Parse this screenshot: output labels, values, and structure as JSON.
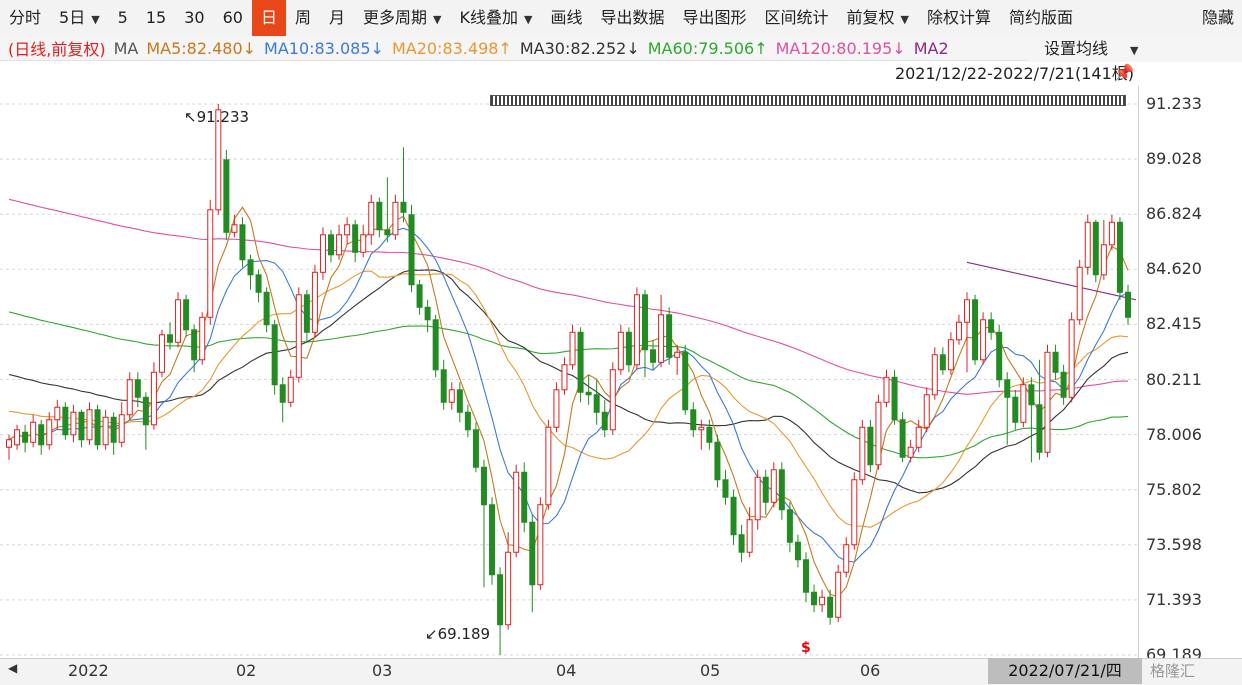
{
  "toolbar": {
    "items": [
      "分时",
      "5日",
      "5",
      "15",
      "30",
      "60",
      "日",
      "周",
      "月",
      "更多周期",
      "K线叠加",
      "画线",
      "导出数据",
      "导出图形",
      "区间统计",
      "前复权",
      "除权计算",
      "简约版面"
    ],
    "right_label": "隐藏",
    "active": "日"
  },
  "ma": {
    "prefix": "(日线,前复权)",
    "label": "MA",
    "ma5": "MA5:82.480↓",
    "ma10": "MA10:83.085↓",
    "ma20": "MA20:83.498↑",
    "ma30": "MA30:82.252↓",
    "ma60": "MA60:79.506↑",
    "ma120": "MA120:80.195↓",
    "ma250": "MA2",
    "settings": "设置均线"
  },
  "range": "2021/12/22-2022/7/21(141根)",
  "annotations": {
    "high": "91.233",
    "low": "69.189",
    "signal": "$"
  },
  "price_axis": [
    "91.233",
    "89.028",
    "86.824",
    "84.620",
    "82.415",
    "80.211",
    "78.006",
    "75.802",
    "73.598",
    "71.393",
    "69.189"
  ],
  "time_axis": [
    "2022",
    "02",
    "03",
    "04",
    "05",
    "06"
  ],
  "current_date": "2022/07/21/四",
  "logo": "格隆汇",
  "colors": {
    "up": "#e02020",
    "down": "#228b22",
    "ma5": "#c8781e",
    "ma10": "#3a7ad8",
    "ma20": "#e89830",
    "ma30": "#333333",
    "ma60": "#2ea82e",
    "ma120": "#e050a0",
    "ma250": "#8a2a8a"
  },
  "chart_data": {
    "type": "candlestick",
    "ylim": [
      69.189,
      91.233
    ],
    "candles": [
      [
        77.5,
        77.8,
        77.0,
        78.0
      ],
      [
        77.6,
        78.2,
        77.4,
        78.4
      ],
      [
        78.1,
        77.7,
        77.3,
        78.4
      ],
      [
        77.7,
        78.5,
        77.5,
        78.8
      ],
      [
        78.4,
        77.6,
        77.2,
        78.6
      ],
      [
        77.6,
        78.6,
        77.4,
        78.9
      ],
      [
        78.6,
        79.1,
        78.2,
        79.4
      ],
      [
        79.1,
        78.0,
        77.8,
        79.3
      ],
      [
        78.0,
        78.9,
        77.7,
        79.2
      ],
      [
        78.9,
        77.8,
        77.5,
        79.0
      ],
      [
        77.8,
        79.0,
        77.6,
        79.3
      ],
      [
        79.0,
        77.6,
        77.4,
        79.2
      ],
      [
        77.6,
        78.7,
        77.4,
        79.0
      ],
      [
        78.7,
        77.7,
        77.2,
        78.9
      ],
      [
        77.7,
        78.8,
        77.5,
        79.3
      ],
      [
        78.8,
        80.2,
        78.6,
        80.5
      ],
      [
        80.2,
        79.5,
        79.1,
        80.5
      ],
      [
        79.5,
        78.4,
        77.4,
        79.7
      ],
      [
        78.4,
        80.5,
        78.2,
        80.9
      ],
      [
        80.5,
        82.0,
        80.3,
        82.2
      ],
      [
        82.0,
        81.7,
        81.4,
        82.5
      ],
      [
        81.7,
        83.4,
        81.5,
        83.7
      ],
      [
        83.4,
        82.2,
        81.9,
        83.6
      ],
      [
        82.2,
        81.0,
        80.5,
        82.4
      ],
      [
        81.0,
        82.7,
        80.8,
        82.9
      ],
      [
        82.7,
        87.0,
        82.4,
        87.4
      ],
      [
        87.0,
        91.0,
        86.8,
        91.233
      ],
      [
        89.0,
        86.1,
        85.8,
        89.4
      ],
      [
        86.1,
        86.4,
        85.9,
        86.8
      ],
      [
        86.4,
        85.0,
        84.7,
        86.7
      ],
      [
        85.0,
        84.4,
        83.8,
        85.2
      ],
      [
        84.4,
        83.7,
        83.3,
        84.6
      ],
      [
        83.7,
        82.4,
        82.1,
        83.9
      ],
      [
        82.4,
        80.0,
        79.6,
        82.6
      ],
      [
        80.0,
        79.3,
        78.5,
        80.3
      ],
      [
        79.3,
        80.3,
        79.1,
        80.6
      ],
      [
        80.3,
        83.6,
        80.1,
        83.9
      ],
      [
        83.6,
        82.1,
        81.7,
        83.8
      ],
      [
        82.1,
        84.5,
        81.9,
        84.8
      ],
      [
        84.5,
        86.0,
        84.2,
        86.3
      ],
      [
        86.0,
        85.2,
        84.9,
        86.2
      ],
      [
        85.2,
        86.0,
        85.0,
        86.4
      ],
      [
        86.0,
        86.4,
        85.6,
        86.7
      ],
      [
        86.4,
        85.3,
        84.9,
        86.6
      ],
      [
        85.3,
        86.0,
        85.1,
        86.4
      ],
      [
        86.0,
        87.3,
        85.6,
        87.6
      ],
      [
        87.3,
        86.2,
        85.9,
        87.5
      ],
      [
        86.2,
        86.0,
        85.7,
        88.3
      ],
      [
        86.0,
        87.3,
        85.8,
        87.6
      ],
      [
        87.3,
        86.9,
        86.5,
        89.5
      ],
      [
        86.8,
        84.0,
        83.7,
        87.2
      ],
      [
        84.0,
        83.1,
        82.8,
        84.2
      ],
      [
        83.1,
        82.6,
        82.1,
        83.4
      ],
      [
        82.6,
        80.6,
        80.3,
        82.8
      ],
      [
        80.6,
        79.3,
        79.0,
        81.0
      ],
      [
        79.3,
        79.8,
        79.0,
        80.1
      ],
      [
        79.8,
        78.9,
        78.5,
        80.1
      ],
      [
        78.9,
        78.2,
        77.9,
        79.2
      ],
      [
        78.2,
        76.7,
        76.5,
        78.5
      ],
      [
        76.7,
        75.2,
        71.9,
        77.0
      ],
      [
        75.2,
        72.4,
        72.0,
        75.5
      ],
      [
        72.4,
        70.4,
        69.189,
        72.7
      ],
      [
        70.4,
        73.3,
        70.2,
        74.1
      ],
      [
        73.3,
        76.5,
        73.1,
        76.8
      ],
      [
        76.5,
        74.5,
        74.1,
        76.9
      ],
      [
        74.5,
        72.0,
        70.9,
        74.8
      ],
      [
        72.0,
        75.2,
        71.8,
        75.5
      ],
      [
        75.2,
        78.3,
        75.0,
        78.6
      ],
      [
        78.3,
        79.8,
        78.1,
        80.1
      ],
      [
        79.8,
        80.8,
        79.6,
        81.1
      ],
      [
        80.8,
        82.1,
        80.6,
        82.4
      ],
      [
        82.1,
        79.7,
        79.3,
        82.3
      ],
      [
        79.7,
        79.6,
        79.2,
        80.4
      ],
      [
        79.6,
        78.9,
        78.4,
        80.2
      ],
      [
        78.9,
        78.2,
        77.9,
        79.4
      ],
      [
        78.2,
        80.6,
        78.0,
        80.9
      ],
      [
        80.6,
        82.1,
        80.4,
        82.4
      ],
      [
        82.1,
        80.8,
        80.5,
        82.3
      ],
      [
        80.8,
        83.6,
        80.6,
        83.9
      ],
      [
        83.6,
        81.4,
        80.3,
        83.8
      ],
      [
        81.4,
        80.9,
        80.6,
        81.8
      ],
      [
        80.9,
        82.8,
        80.7,
        83.6
      ],
      [
        82.8,
        81.1,
        80.8,
        83.1
      ],
      [
        81.1,
        81.3,
        80.4,
        81.6
      ],
      [
        81.3,
        79.0,
        78.8,
        81.6
      ],
      [
        79.0,
        78.2,
        77.9,
        79.3
      ],
      [
        78.2,
        78.3,
        77.4,
        78.6
      ],
      [
        78.3,
        77.7,
        77.4,
        78.6
      ],
      [
        77.7,
        76.2,
        75.9,
        78.0
      ],
      [
        76.2,
        75.5,
        75.2,
        76.6
      ],
      [
        75.5,
        74.0,
        73.6,
        75.8
      ],
      [
        74.0,
        73.3,
        72.9,
        74.4
      ],
      [
        73.3,
        74.6,
        73.1,
        75.1
      ],
      [
        74.6,
        76.3,
        74.2,
        76.6
      ],
      [
        76.3,
        75.3,
        74.8,
        76.6
      ],
      [
        75.3,
        76.6,
        75.1,
        76.9
      ],
      [
        76.6,
        75.0,
        74.6,
        76.9
      ],
      [
        75.0,
        73.7,
        73.3,
        75.3
      ],
      [
        73.7,
        73.0,
        72.7,
        74.0
      ],
      [
        73.0,
        71.7,
        71.3,
        73.3
      ],
      [
        71.7,
        71.2,
        70.9,
        72.0
      ],
      [
        71.2,
        71.5,
        70.9,
        71.8
      ],
      [
        71.5,
        70.7,
        70.4,
        71.8
      ],
      [
        70.7,
        72.5,
        70.5,
        72.8
      ],
      [
        72.5,
        73.6,
        72.3,
        73.9
      ],
      [
        73.6,
        76.2,
        73.4,
        76.5
      ],
      [
        76.2,
        78.3,
        76.0,
        78.6
      ],
      [
        78.3,
        76.8,
        76.5,
        78.6
      ],
      [
        76.8,
        79.3,
        76.6,
        79.6
      ],
      [
        79.3,
        80.3,
        79.1,
        80.6
      ],
      [
        80.3,
        78.6,
        78.4,
        80.6
      ],
      [
        78.6,
        77.1,
        76.9,
        78.9
      ],
      [
        77.1,
        77.5,
        76.9,
        77.8
      ],
      [
        77.5,
        78.3,
        77.3,
        78.6
      ],
      [
        78.3,
        79.6,
        78.1,
        79.9
      ],
      [
        79.6,
        81.2,
        79.4,
        81.5
      ],
      [
        81.2,
        80.6,
        80.4,
        81.5
      ],
      [
        80.6,
        81.8,
        80.4,
        82.1
      ],
      [
        81.8,
        82.5,
        81.6,
        82.8
      ],
      [
        82.5,
        83.4,
        80.5,
        83.7
      ],
      [
        83.4,
        81.0,
        80.8,
        83.6
      ],
      [
        81.0,
        82.6,
        80.8,
        82.9
      ],
      [
        82.6,
        82.1,
        81.8,
        82.9
      ],
      [
        82.1,
        80.2,
        79.9,
        82.4
      ],
      [
        80.2,
        79.5,
        77.6,
        80.5
      ],
      [
        79.5,
        78.5,
        78.2,
        79.8
      ],
      [
        78.5,
        80.0,
        78.3,
        80.3
      ],
      [
        80.0,
        79.2,
        76.9,
        80.3
      ],
      [
        79.2,
        77.3,
        77.0,
        81.0
      ],
      [
        77.3,
        81.3,
        77.1,
        81.6
      ],
      [
        81.3,
        80.5,
        80.2,
        81.6
      ],
      [
        80.5,
        79.5,
        79.2,
        80.8
      ],
      [
        79.5,
        82.6,
        79.3,
        82.9
      ],
      [
        82.6,
        84.7,
        82.4,
        85.0
      ],
      [
        84.7,
        86.5,
        84.4,
        86.8
      ],
      [
        86.5,
        84.4,
        84.1,
        86.6
      ],
      [
        84.4,
        85.6,
        84.2,
        86.6
      ],
      [
        85.6,
        86.5,
        85.4,
        86.8
      ],
      [
        86.5,
        83.7,
        83.4,
        86.7
      ],
      [
        83.7,
        82.7,
        82.4,
        84.0
      ]
    ]
  }
}
